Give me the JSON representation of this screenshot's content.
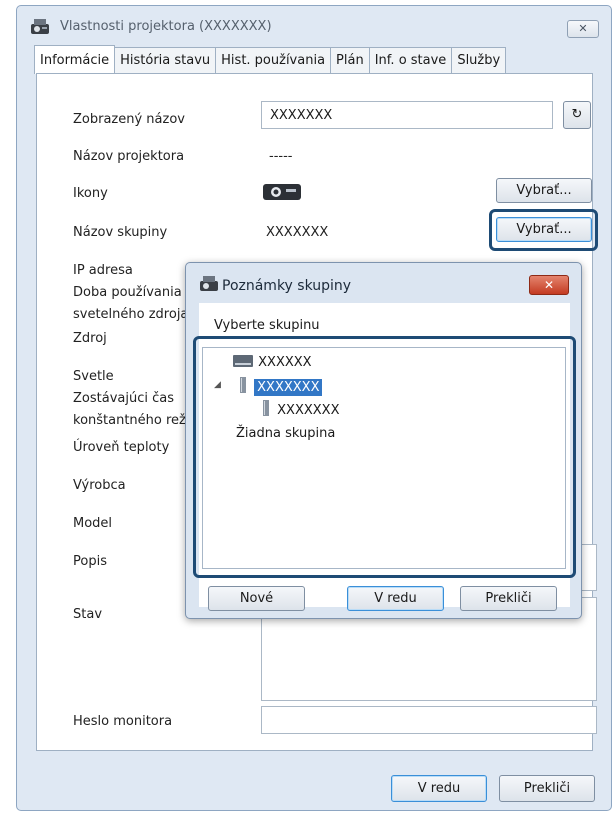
{
  "window": {
    "title": "Vlastnosti projektora (XXXXXXX)",
    "close_label": "✕"
  },
  "tabs": [
    {
      "label": "Informácie",
      "active": true
    },
    {
      "label": "História stavu"
    },
    {
      "label": "Hist. používania"
    },
    {
      "label": "Plán"
    },
    {
      "label": "Inf. o stave"
    },
    {
      "label": "Služby"
    }
  ],
  "info": {
    "display_name_label": "Zobrazený názov",
    "display_name_value": "XXXXXXX",
    "projector_name_label": "Názov projektora",
    "projector_name_value": "-----",
    "icons_label": "Ikony",
    "group_name_label": "Názov skupiny",
    "group_name_value": "XXXXXXX",
    "select_button": "Vybrať...",
    "ip_label": "IP adresa",
    "light_usage_label_1": "Doba používania",
    "light_usage_label_2": "svetelného zdroja",
    "source_label": "Zdroj",
    "brightness_label": "Svetle",
    "remaining_label_1": "Zostávajúci čas",
    "remaining_label_2": "konštantného reži",
    "temperature_label": "Úroveň teploty",
    "manufacturer_label": "Výrobca",
    "model_label": "Model",
    "description_label": "Popis",
    "status_label": "Stav",
    "monitor_password_label": "Heslo monitora"
  },
  "footer": {
    "ok_label": "V redu",
    "cancel_label": "Prekliči"
  },
  "dialog": {
    "title": "Poznámky skupiny",
    "close_label": "✕",
    "prompt": "Vyberte skupinu",
    "tree": [
      {
        "label": "XXXXXX",
        "icon": "disk-icon",
        "level": 0
      },
      {
        "label": "XXXXXXX",
        "icon": "group-folder-icon",
        "level": 0,
        "selected": true,
        "expanded": true
      },
      {
        "label": "XXXXXXX",
        "icon": "group-folder-icon",
        "level": 1
      },
      {
        "label": "Žiadna skupina",
        "level": 0
      }
    ],
    "new_button": "Nové",
    "ok_button": "V redu",
    "cancel_button": "Prekliči"
  },
  "colors": {
    "window_bg": "#dfe8f3",
    "highlight_border": "#1e4b75",
    "selection": "#3277c6",
    "dialog_close": "#c33b22"
  }
}
